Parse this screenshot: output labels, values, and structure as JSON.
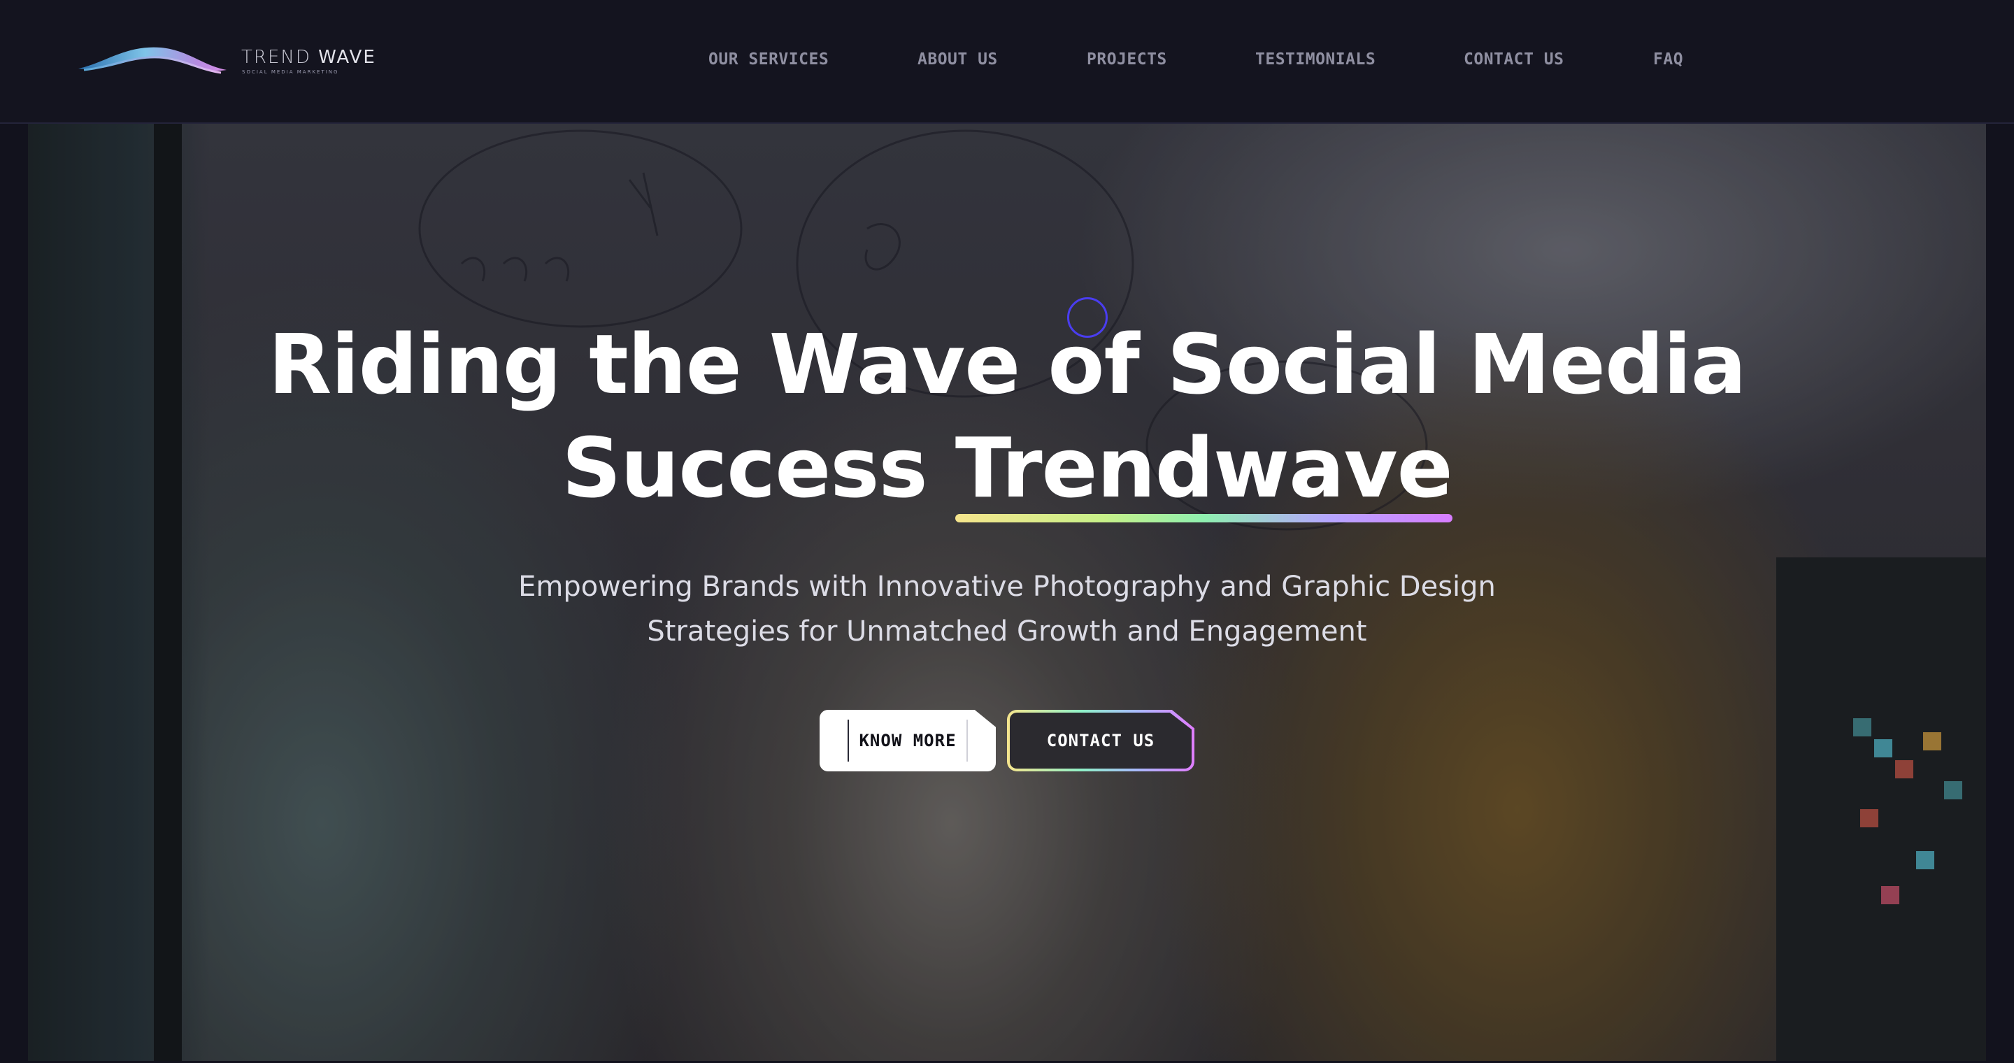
{
  "brand": {
    "name_light": "TREND",
    "name_bold": "WAVE",
    "tagline": "SOCIAL MEDIA MARKETING"
  },
  "nav": {
    "items": [
      {
        "label": "OUR SERVICES"
      },
      {
        "label": "ABOUT US"
      },
      {
        "label": "PROJECTS"
      },
      {
        "label": "TESTIMONIALS"
      },
      {
        "label": "CONTACT US"
      },
      {
        "label": "FAQ"
      }
    ]
  },
  "hero": {
    "headline_line1": "Riding the Wave of Social Media",
    "headline_line2_prefix": "Success",
    "headline_highlight": "Trendwave",
    "subtitle_line1": "Empowering Brands with Innovative Photography and Graphic Design",
    "subtitle_line2": "Strategies for Unmatched Growth and Engagement",
    "know_more_label": "KNOW MORE",
    "contact_label": "CONTACT US"
  },
  "colors": {
    "header_bg": "#14141f",
    "nav_text": "#8f8fa1",
    "headline": "#ffffff",
    "gradient_start": "#f6e58d",
    "gradient_mid": "#8ff0b0",
    "gradient_end": "#d77dff",
    "cursor_ring": "#4a3df0"
  },
  "icons": {
    "logo": "wave-logo-icon",
    "cursor": "cursor-ring-icon"
  }
}
